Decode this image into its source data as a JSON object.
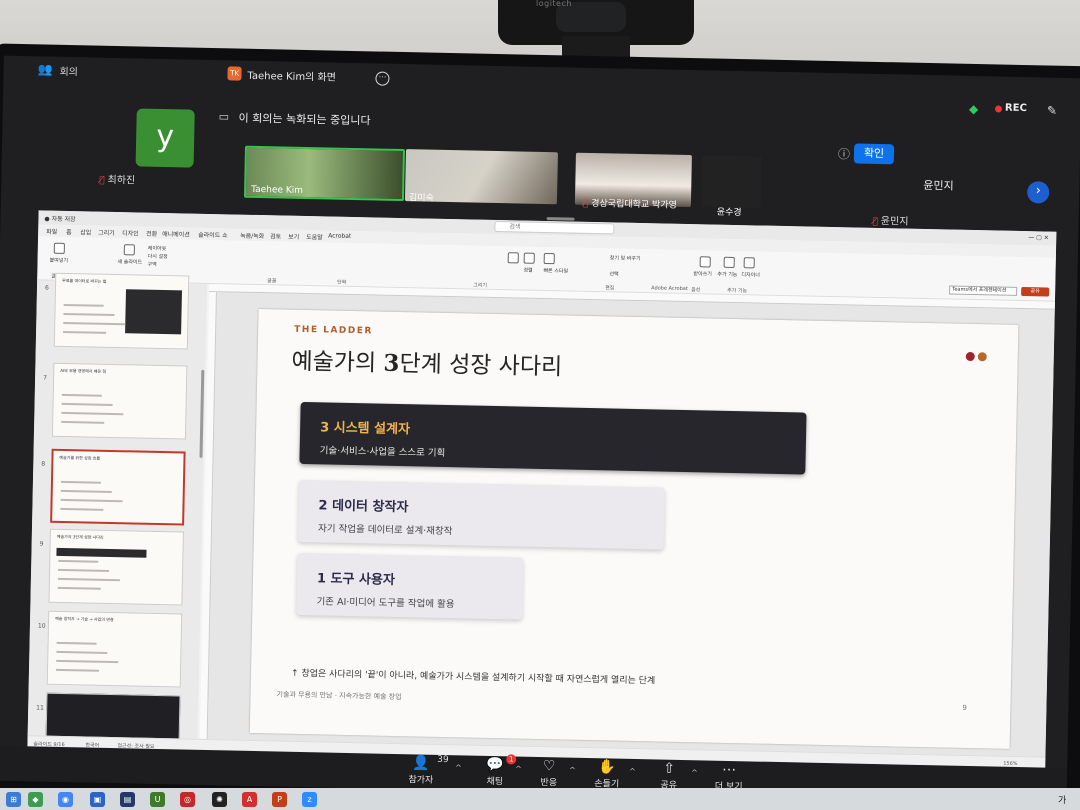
{
  "webcam": {
    "brand": "logitech"
  },
  "zoom": {
    "meeting_label": "회의",
    "sharer_initials": "TK",
    "sharer_label": "Taehee Kim의 화면",
    "recording_notice": "이 회의는 녹화되는 중입니다",
    "rec_label": "REC",
    "confirm_label": "확인",
    "participants": {
      "tile_letter": "y",
      "choi": "최하진",
      "video1": "Taehee Kim",
      "video2": "김미숙",
      "video3": "경상국립대학교 박가영",
      "video4": "윤수경",
      "yoon_big": "윤민지",
      "yoon_small": "윤민지"
    },
    "toolbar": {
      "participants_count": "39",
      "participants": "참가자",
      "chat_badge": "1",
      "chat": "채팅",
      "react": "반응",
      "raise_hand": "손들기",
      "share": "공유",
      "more": "더 보기"
    }
  },
  "ppt": {
    "search_placeholder": "검색",
    "tabs": [
      "파일",
      "홈",
      "삽입",
      "그리기",
      "디자인",
      "전환",
      "애니메이션",
      "슬라이드 쇼",
      "녹음/녹화",
      "검토",
      "보기",
      "도움말",
      "Acrobat"
    ],
    "ribbon_groups": [
      "클립보드",
      "슬라이드",
      "글꼴",
      "단락",
      "그리기",
      "편집",
      "Adobe Acrobat",
      "음성",
      "추가 기능"
    ],
    "ribbon_buttons": [
      "붙여넣기",
      "새 슬라이드",
      "레이아웃",
      "다시 설정",
      "구역",
      "정렬",
      "빠른 스타일",
      "찾기 및 바꾸기",
      "선택",
      "받아쓰기",
      "추가 기능",
      "디자이너"
    ],
    "teams_btn": "Teams에서 프레젠테이션",
    "share_btn": "공유",
    "thumbs": [
      {
        "num": "6",
        "title": "무료를 데이터로 바꾸는 법"
      },
      {
        "num": "7",
        "title": "AI와 무용 경영에서 배운 점"
      },
      {
        "num": "8",
        "title": "예술가를 위한 성장 흐름"
      },
      {
        "num": "9",
        "title": "예술가의 3단계 성장 사다리"
      },
      {
        "num": "10",
        "title": "예술 창작자 → 기술 → 사업의 연결"
      },
      {
        "num": "11",
        "title": ""
      }
    ],
    "status": {
      "slide": "슬라이드 9/16",
      "lang": "한국어",
      "access": "접근성: 조사 필요",
      "zoom": "156%"
    }
  },
  "slide": {
    "eyebrow": "THE LADDER",
    "title_pre": "예술가의 ",
    "title_bold": "3",
    "title_post": "단계 성장 사다리",
    "steps": [
      {
        "title": "3  시스템 설계자",
        "desc": "기술·서비스·사업을 스스로 기획"
      },
      {
        "title": "2  데이터 창작자",
        "desc": "자기 작업을 데이터로 설계·재창작"
      },
      {
        "title": "1  도구 사용자",
        "desc": "기존 AI·미디어 도구를 작업에 활용"
      }
    ],
    "note": "↑ 창업은 사다리의 '끝'이 아니라, 예술가가 시스템을 설계하기 시작할 때 자연스럽게 열리는 단계",
    "footer": "기술과 무용의 만남 · 지속가능한 예술 창업",
    "page_number": "9"
  },
  "taskbar": {
    "time": "가"
  },
  "colors": {
    "accent": "#b35e2a",
    "step_dark": "#26262c",
    "step_title_gold": "#f2b34a",
    "zoom_blue": "#0e72ed",
    "rec_red": "#e33333"
  }
}
